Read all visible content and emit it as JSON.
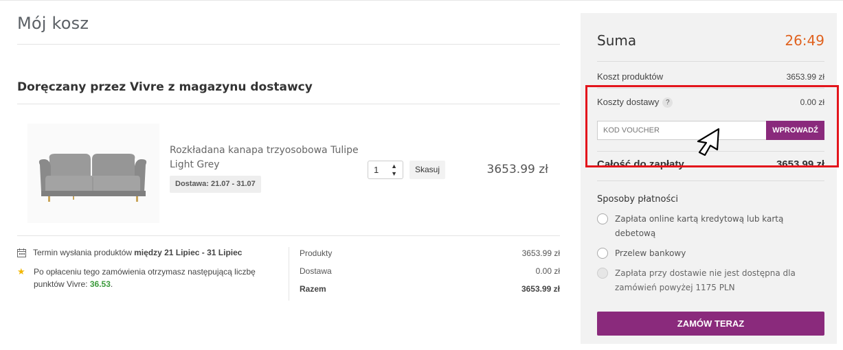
{
  "cart": {
    "title": "Mój kosz",
    "section_title": "Doręczany przez Vivre z magazynu dostawcy",
    "item": {
      "name": "Rozkładana kanapa trzyosobowa Tulipe Light Grey",
      "delivery": "Dostawa: 21.07 - 31.07",
      "quantity": "1",
      "remove_label": "Skasuj",
      "price": "3653.99 zł",
      "image_icon": "sofa-image"
    },
    "shipping_note": {
      "prefix": "Termin wysłania produktów",
      "range": "między 21 Lipiec - 31 Lipiec"
    },
    "points_note": {
      "text": "Po opłaceniu tego zamówienia otrzymasz następującą liczbę punktów Vivre:",
      "points": "36.53",
      "suffix": "."
    },
    "summary": [
      {
        "label": "Produkty",
        "value": "3653.99 zł"
      },
      {
        "label": "Dostawa",
        "value": "0.00 zł"
      },
      {
        "label": "Razem",
        "value": "3653.99 zł"
      }
    ]
  },
  "panel": {
    "title": "Suma",
    "timer": "26:49",
    "products_cost_label": "Koszt produktów",
    "products_cost_value": "3653.99 zł",
    "delivery_cost_label": "Koszty dostawy",
    "delivery_help": "?",
    "delivery_cost_value": "0.00 zł",
    "voucher_placeholder": "KOD VOUCHER",
    "voucher_button": "WPROWADŹ",
    "grand_total_label": "Całość do zapłaty",
    "grand_total_value": "3653.99 zł",
    "payment_title": "Sposoby płatności",
    "payment_options": [
      {
        "label": "Zapłata online kartą kredytową lub kartą debetową",
        "disabled": false
      },
      {
        "label": "Przelew bankowy",
        "disabled": false
      },
      {
        "label": "Zapłata przy dostawie nie jest dostępna dla zamówień powyżej 1175 PLN",
        "disabled": true
      }
    ],
    "order_button": "ZAMÓW TERAZ"
  },
  "colors": {
    "accent": "#8a2a7c",
    "timer": "#e0621f",
    "highlight": "#e3141b",
    "points": "#3b9a3b"
  }
}
